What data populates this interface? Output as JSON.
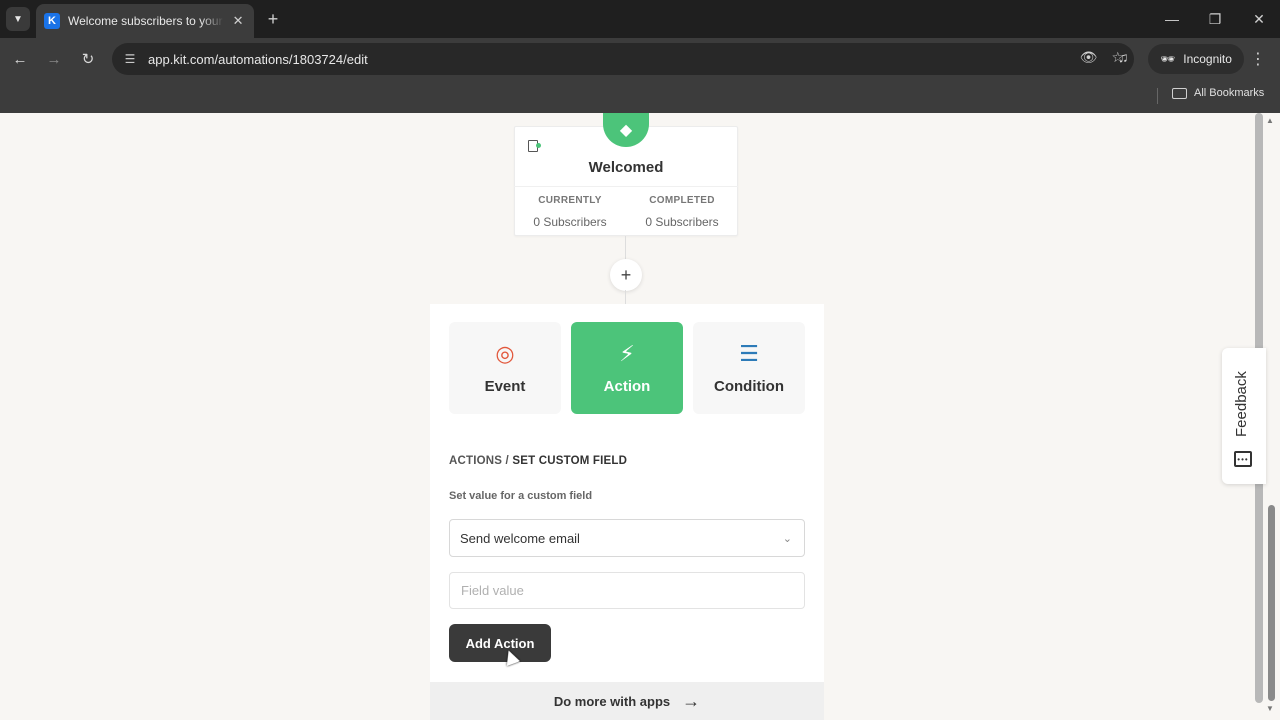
{
  "browser": {
    "tab_title": "Welcome subscribers to your p",
    "tab_favicon": "K",
    "url": "app.kit.com/automations/1803724/edit",
    "incognito_label": "Incognito",
    "bookmarks_label": "All Bookmarks"
  },
  "step": {
    "title": "Welcomed",
    "stats": [
      {
        "label": "CURRENTLY",
        "value": "0 Subscribers"
      },
      {
        "label": "COMPLETED",
        "value": "0 Subscribers"
      }
    ],
    "icon": "tag-icon"
  },
  "panel": {
    "types": [
      {
        "label": "Event",
        "icon": "target-icon",
        "color": "#e2573b"
      },
      {
        "label": "Action",
        "icon": "bolt-icon",
        "color": "#ffffff",
        "active": true
      },
      {
        "label": "Condition",
        "icon": "signpost-icon",
        "color": "#2d7bb8"
      }
    ],
    "breadcrumb_parent": "ACTIONS",
    "breadcrumb_sep": " / ",
    "breadcrumb_current": "SET CUSTOM FIELD",
    "caption": "Set value for a custom field",
    "select_value": "Send welcome email",
    "field_placeholder": "Field value",
    "submit_label": "Add Action"
  },
  "apps_link": "Do more with apps",
  "feedback_label": "Feedback",
  "colors": {
    "accent_green": "#4cc47a",
    "dark_button": "#3a3a3a"
  }
}
